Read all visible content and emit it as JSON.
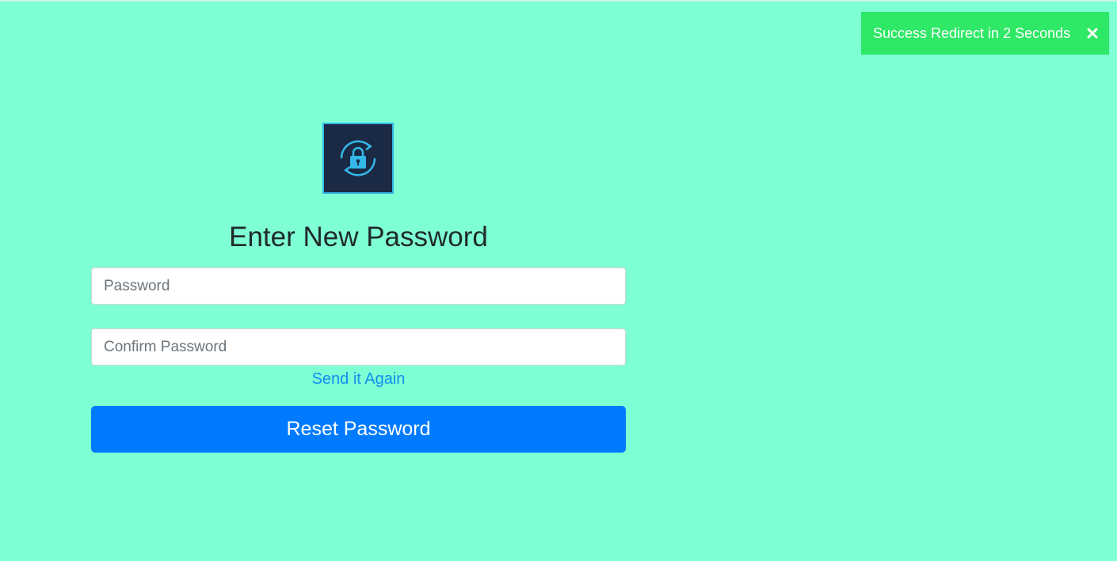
{
  "toast": {
    "message": "Success Redirect in 2 Seconds",
    "close_icon": "close-icon",
    "background_color": "#2ee866"
  },
  "logo": {
    "icon": "lock-refresh-icon",
    "background_color": "#1b2a44",
    "accent_color": "#33b8e8"
  },
  "form": {
    "title": "Enter New Password",
    "password_placeholder": "Password",
    "password_value": "",
    "confirm_placeholder": "Confirm Password",
    "confirm_value": "",
    "send_again_label": "Send it Again",
    "submit_label": "Reset Password",
    "submit_color": "#007bff"
  },
  "page": {
    "background_color": "#7fffd4"
  }
}
